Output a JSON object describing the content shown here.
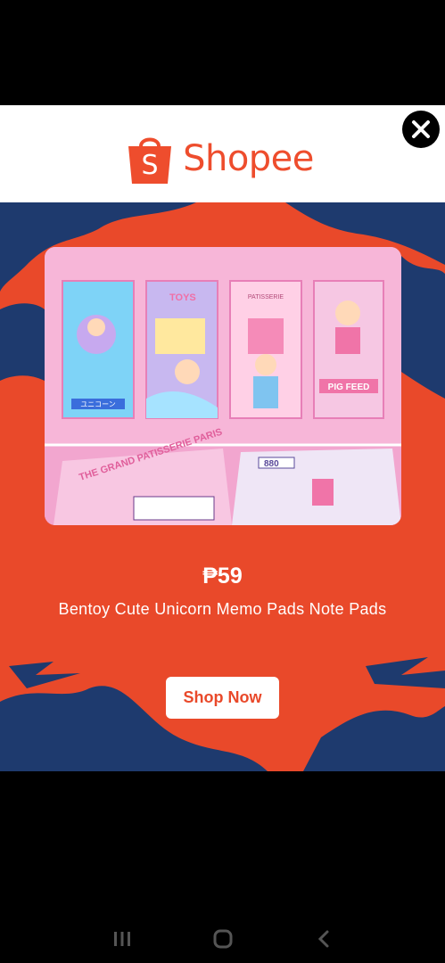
{
  "ad": {
    "brand_name": "Shopee",
    "brand_color": "#ee4d2d",
    "background_color": "#e9492a",
    "accent_dark": "#1e3a6e",
    "close_icon": "close-icon",
    "product": {
      "price": "₱59",
      "title": "Bentoy Cute Unicorn Memo Pads Note Pads"
    },
    "cta_label": "Shop Now"
  },
  "product_image": {
    "pads": [
      {
        "label": "ユニコーン",
        "color": "#7ed3f7"
      },
      {
        "label": "TOYS",
        "color": "#c8b8f0"
      },
      {
        "label": "PATISSERIE",
        "color": "#ffd0e6"
      },
      {
        "label": "PIG FEED",
        "color": "#f6c7e3"
      }
    ],
    "lower_left_text": "THE GRAND PATISSERIE PARIS",
    "lower_right_text": "880"
  },
  "system_nav": {
    "recent_icon": "recent-apps-icon",
    "home_icon": "home-icon",
    "back_icon": "back-icon"
  }
}
